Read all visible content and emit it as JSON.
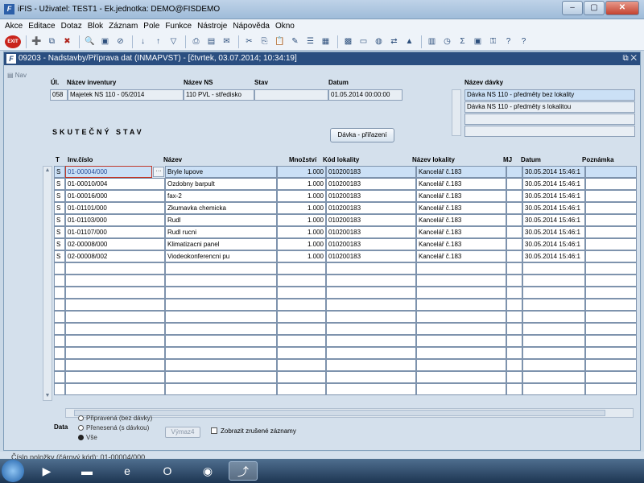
{
  "window": {
    "title": "iFIS - Uživatel: TEST1 - Ek.jednotka: DEMO@FISDEMO",
    "icon": "ifis-app-icon"
  },
  "menu": [
    "Akce",
    "Editace",
    "Dotaz",
    "Blok",
    "Záznam",
    "Pole",
    "Funkce",
    "Nástroje",
    "Nápověda",
    "Okno"
  ],
  "toolbar": {
    "exit_label": "EXIT"
  },
  "form": {
    "title": "09203 - Nadstavby/Příprava dat (INMAPVST) - [čtvrtek, 03.07.2014; 10:34:19]",
    "nav_label": "Nav",
    "header_labels": {
      "ul": "Úl.",
      "nazev_inventury": "Název inventury",
      "nazev_ns": "Název NS",
      "stav": "Stav",
      "datum": "Datum",
      "nazev_davky": "Název dávky"
    },
    "header_values": {
      "ul": "058",
      "nazev_inventury": "Majetek NS 110 - 05/2014",
      "nazev_ns": "110 PVL - středisko",
      "stav": "",
      "datum": "01.05.2014 00:00:00"
    },
    "davky": [
      "Dávka NS 110 - předměty bez lokality",
      "Dávka NS 110 - předměty s lokalitou",
      "",
      ""
    ],
    "section_title": "SKUTEČNÝ STAV",
    "davka_button": "Dávka - přiřazení"
  },
  "grid": {
    "columns": [
      "T",
      "Inv.číslo",
      "Název",
      "Množství",
      "Kód lokality",
      "Název lokality",
      "MJ",
      "Datum",
      "Poznámka"
    ],
    "rows": [
      {
        "t": "S",
        "inv": "01-00004/000",
        "nazev": "Bryle lupove",
        "mnozstvi": "1.000",
        "kod": "010200183",
        "lokalita": "Kancelář č.183",
        "mj": "",
        "datum": "30.05.2014 15:46:1",
        "poznamka": ""
      },
      {
        "t": "S",
        "inv": "01-00010/004",
        "nazev": "Ozdobny barpult",
        "mnozstvi": "1.000",
        "kod": "010200183",
        "lokalita": "Kancelář č.183",
        "mj": "",
        "datum": "30.05.2014 15:46:1",
        "poznamka": ""
      },
      {
        "t": "S",
        "inv": "01-00016/000",
        "nazev": "fax-2",
        "mnozstvi": "1.000",
        "kod": "010200183",
        "lokalita": "Kancelář č.183",
        "mj": "",
        "datum": "30.05.2014 15:46:1",
        "poznamka": ""
      },
      {
        "t": "S",
        "inv": "01-01101/000",
        "nazev": "Zkumavka chemicka",
        "mnozstvi": "1.000",
        "kod": "010200183",
        "lokalita": "Kancelář č.183",
        "mj": "",
        "datum": "30.05.2014 15:46:1",
        "poznamka": ""
      },
      {
        "t": "S",
        "inv": "01-01103/000",
        "nazev": "Rudl",
        "mnozstvi": "1.000",
        "kod": "010200183",
        "lokalita": "Kancelář č.183",
        "mj": "",
        "datum": "30.05.2014 15:46:1",
        "poznamka": ""
      },
      {
        "t": "S",
        "inv": "01-01107/000",
        "nazev": "Rudl rucni",
        "mnozstvi": "1.000",
        "kod": "010200183",
        "lokalita": "Kancelář č.183",
        "mj": "",
        "datum": "30.05.2014 15:46:1",
        "poznamka": ""
      },
      {
        "t": "S",
        "inv": "02-00008/000",
        "nazev": "Klimatizacni panel",
        "mnozstvi": "1.000",
        "kod": "010200183",
        "lokalita": "Kancelář č.183",
        "mj": "",
        "datum": "30.05.2014 15:46:1",
        "poznamka": ""
      },
      {
        "t": "S",
        "inv": "02-00008/002",
        "nazev": "Viodeokonferencni pu",
        "mnozstvi": "1.000",
        "kod": "010200183",
        "lokalita": "Kancelář č.183",
        "mj": "",
        "datum": "30.05.2014 15:46:1",
        "poznamka": ""
      }
    ]
  },
  "filter": {
    "label": "Data",
    "options": [
      "Připravená (bez dávky)",
      "Přenesená (s dávkou)",
      "Vše"
    ],
    "selected": "Vše",
    "vymaz_button": "Výmaz4",
    "show_cancelled_label": "Zobrazit zrušené záznamy"
  },
  "status": {
    "text": "Číslo položky (čárový kód): 01-00004/000"
  },
  "taskbar": [
    "start-orb-icon",
    "media-player-icon",
    "folder-icon",
    "internet-explorer-icon",
    "outlook-icon",
    "chrome-icon",
    "ifis-task-icon"
  ]
}
